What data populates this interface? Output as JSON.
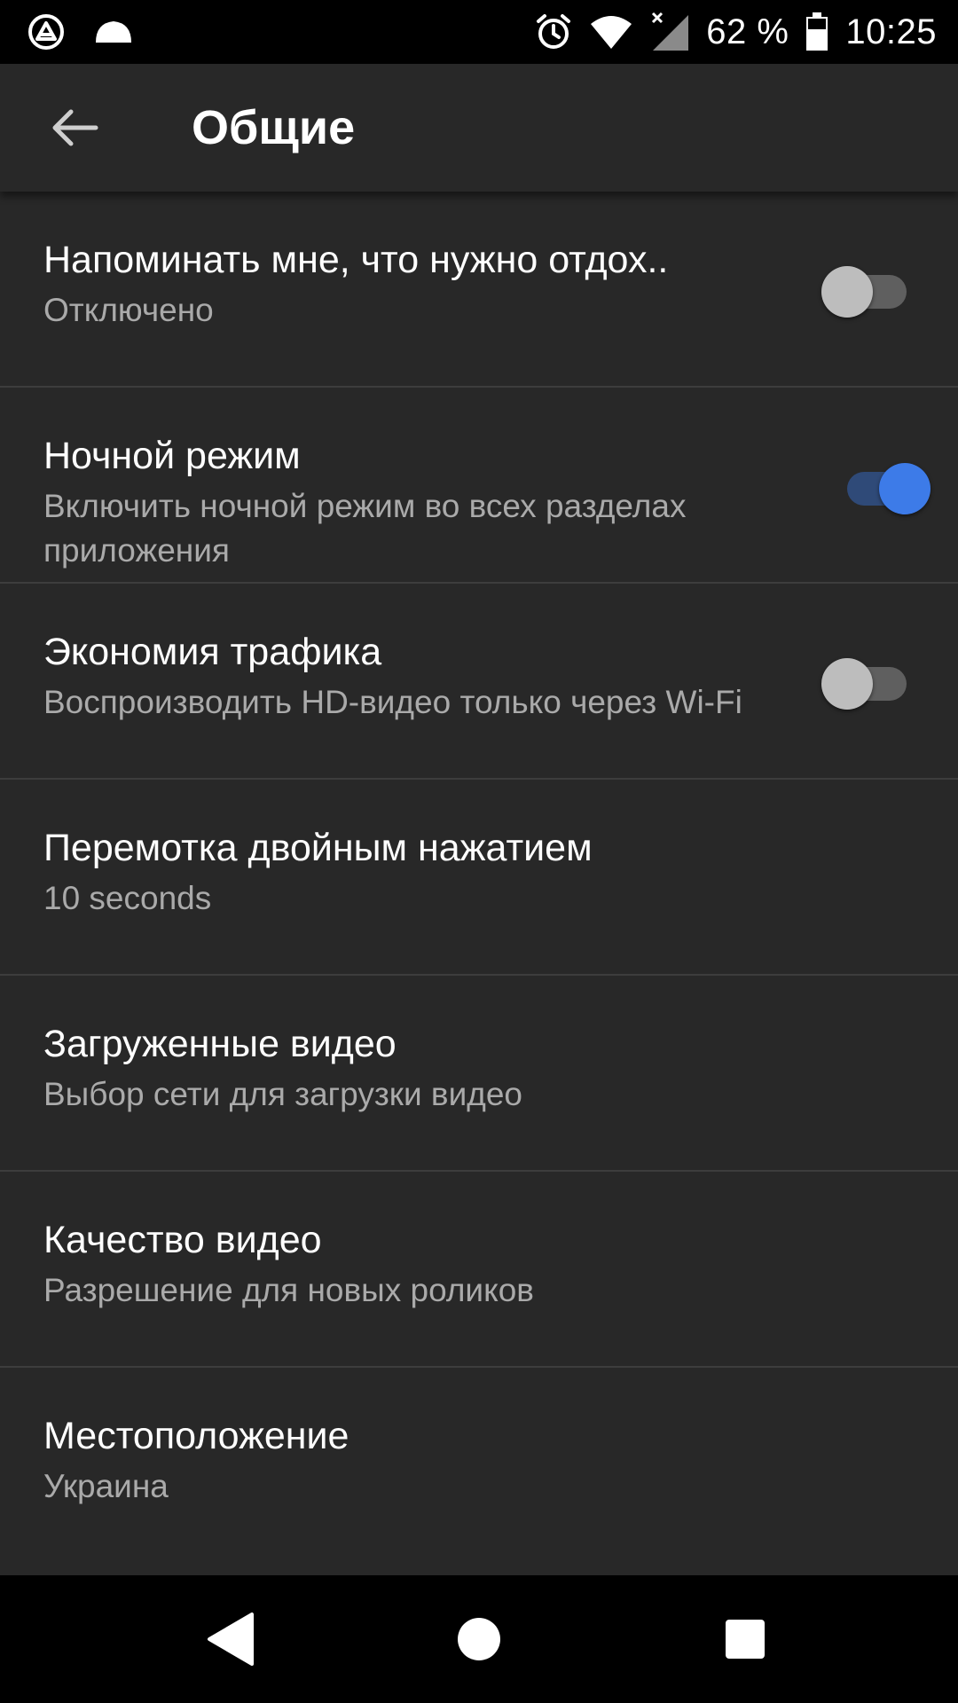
{
  "status_bar": {
    "battery_percent": "62 %",
    "time": "10:25",
    "icons": [
      "app-icon",
      "cloud-icon",
      "alarm-icon",
      "wifi-icon",
      "signal-icon",
      "battery-icon"
    ]
  },
  "app_bar": {
    "title": "Общие",
    "back_icon": "arrow-back-icon"
  },
  "settings": [
    {
      "title": "Напоминать мне, что нужно отдох..",
      "subtitle": "Отключено",
      "toggle": false
    },
    {
      "title": "Ночной режим",
      "subtitle": "Включить ночной режим во всех разделах приложения",
      "toggle": true
    },
    {
      "title": "Экономия трафика",
      "subtitle": "Воспроизводить HD-видео только через Wi-Fi",
      "toggle": false
    },
    {
      "title": "Перемотка двойным нажатием",
      "subtitle": "10 seconds"
    },
    {
      "title": "Загруженные видео",
      "subtitle": "Выбор сети для загрузки видео"
    },
    {
      "title": "Качество видео",
      "subtitle": "Разрешение для новых роликов"
    },
    {
      "title": "Местоположение",
      "subtitle": "Украина"
    }
  ],
  "nav_bar": {
    "icons": [
      "back-triangle-icon",
      "home-circle-icon",
      "recents-square-icon"
    ]
  },
  "colors": {
    "background": "#282828",
    "toggle_on_thumb": "#3d7be8",
    "toggle_on_track": "#2f4a78",
    "toggle_off_thumb": "#bdbdbd",
    "toggle_off_track": "#5f5f5f"
  }
}
